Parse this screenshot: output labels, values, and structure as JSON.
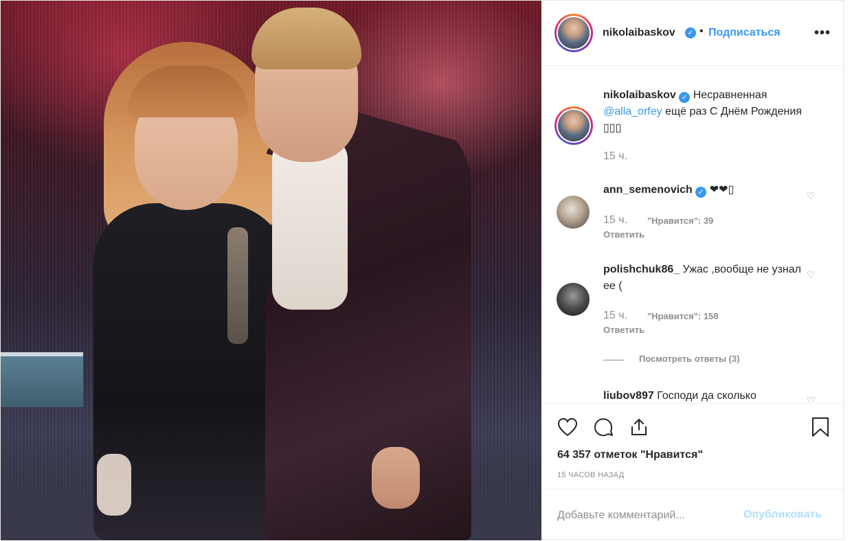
{
  "post": {
    "author": {
      "username": "nikolaibaskov",
      "verified_icon": "verified-badge-icon",
      "follow_label": "Подписаться",
      "separator": "•",
      "more_label": "•••"
    },
    "caption": {
      "username": "nikolaibaskov",
      "text_before": "Несравненная",
      "mention": "@alla_orfey",
      "text_after": "ещё раз С Днём Рождения ▯▯▯",
      "time": "15 ч."
    },
    "comments": [
      {
        "username": "ann_semenovich",
        "verified": true,
        "text": "❤❤▯",
        "time": "15 ч.",
        "likes_label": "\"Нравится\": 39",
        "reply_label": "Ответить"
      },
      {
        "username": "polishchuk86_",
        "verified": false,
        "text": "Ужас ,вообще не узнал ее (",
        "time": "15 ч.",
        "likes_label": "\"Нравится\": 158",
        "reply_label": "Ответить",
        "view_replies_label": "Посмотреть ответы (3)"
      },
      {
        "username": "liubov897",
        "verified": false,
        "text": "Господи да сколько"
      }
    ],
    "likes_count_label": "64 357 отметок \"Нравится\"",
    "timestamp_label": "15 ЧАСОВ НАЗАД",
    "comment_box": {
      "placeholder": "Добавьте комментарий...",
      "publish_label": "Опубликовать"
    },
    "colors": {
      "link_blue": "#3897f0",
      "muted": "#8e8e8e",
      "text": "#262626",
      "publish_disabled": "#b2dffc"
    }
  }
}
